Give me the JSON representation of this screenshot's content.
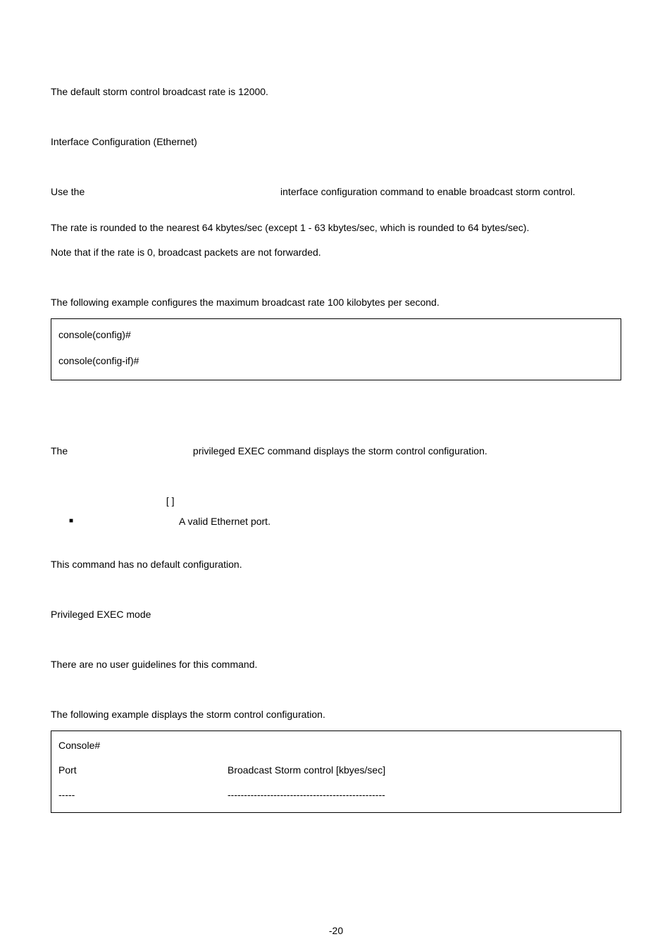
{
  "default_conf": "The default storm control broadcast rate is 12000.",
  "cmd_mode_1": "Interface Configuration (Ethernet)",
  "guide_1_a": "Use the",
  "guide_1_b": "interface configuration command to enable broadcast storm control.",
  "guide_2": "The rate is rounded to the nearest 64 kbytes/sec (except 1 - 63 kbytes/sec, which is rounded to 64 bytes/sec).",
  "guide_3": "Note that if the rate is 0, broadcast packets are not forwarded.",
  "example_intro_1": "The following example configures the maximum broadcast rate 100 kilobytes per second.",
  "code1_line1": "console(config)#",
  "code1_line2": "console(config-if)#",
  "desc_a": "The",
  "desc_b": "privileged EXEC command displays the storm control configuration.",
  "syntax_brackets": "[                        ]",
  "syntax_bullet_text": "A valid Ethernet port.",
  "default_conf_2": "This command has no default configuration.",
  "cmd_mode_2": "Privileged EXEC mode",
  "guidelines_2": "There are no user guidelines for this command.",
  "example_intro_2": "The following example displays the storm control configuration.",
  "ex2_line1": "Console#",
  "ex2_row_port": "Port",
  "ex2_row_bcast": "Broadcast Storm control [kbyes/sec]",
  "ex2_dash1": "-----",
  "ex2_dash2": "------------------------------------------------",
  "page_number": "-20"
}
